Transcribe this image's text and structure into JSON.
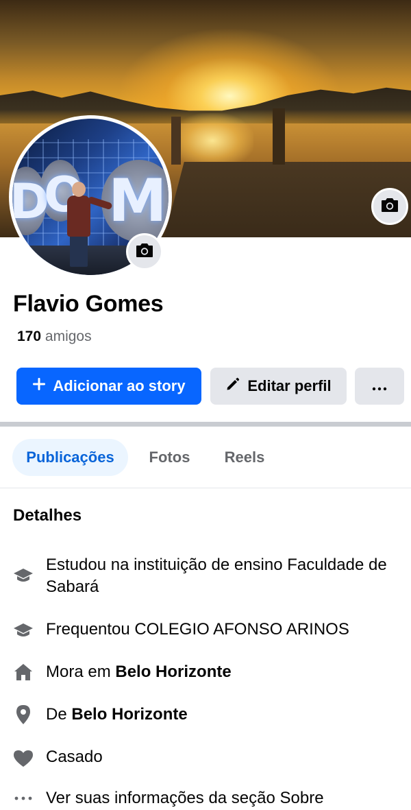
{
  "profile": {
    "name": "Flavio Gomes",
    "friends_count": "170",
    "friends_label": "amigos"
  },
  "actions": {
    "add_story_label": "Adicionar ao story",
    "edit_profile_label": "Editar perfil",
    "more_label": "···"
  },
  "tabs": [
    {
      "label": "Publicações",
      "active": true
    },
    {
      "label": "Fotos",
      "active": false
    },
    {
      "label": "Reels",
      "active": false
    }
  ],
  "details": {
    "title": "Detalhes",
    "items": [
      {
        "icon": "graduation-cap-icon",
        "text": "Estudou na instituição de ensino Faculdade de Sabará"
      },
      {
        "icon": "graduation-cap-icon",
        "text": "Frequentou COLEGIO AFONSO ARINOS"
      },
      {
        "icon": "home-icon",
        "prefix": "Mora em ",
        "bold": "Belo Horizonte"
      },
      {
        "icon": "location-pin-icon",
        "prefix": "De ",
        "bold": "Belo Horizonte"
      },
      {
        "icon": "heart-icon",
        "text": "Casado"
      },
      {
        "icon": "more-dots-icon",
        "text": "Ver suas informações da seção Sobre"
      }
    ]
  },
  "colors": {
    "primary": "#0866ff",
    "secondary_button": "#e4e6eb",
    "active_tab_bg": "#ebf5ff",
    "active_tab_text": "#0864d9",
    "muted_text": "#65676b",
    "icon_gray": "#65676b"
  }
}
